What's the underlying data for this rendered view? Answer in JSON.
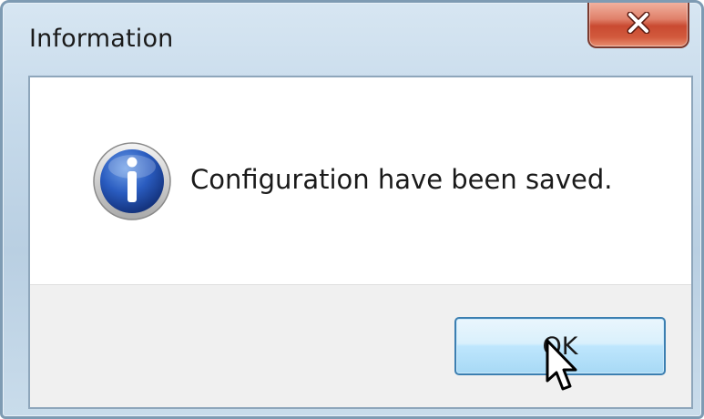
{
  "dialog": {
    "title": "Information",
    "message": "Configuration have been saved.",
    "ok_label": "OK",
    "close_icon": "close-icon",
    "message_icon": "information-icon"
  },
  "colors": {
    "titlebar": "#c5d9ea",
    "close_button": "#c94a31",
    "ok_button_border": "#3c7fb1",
    "info_icon_blue": "#1f4fa8"
  }
}
